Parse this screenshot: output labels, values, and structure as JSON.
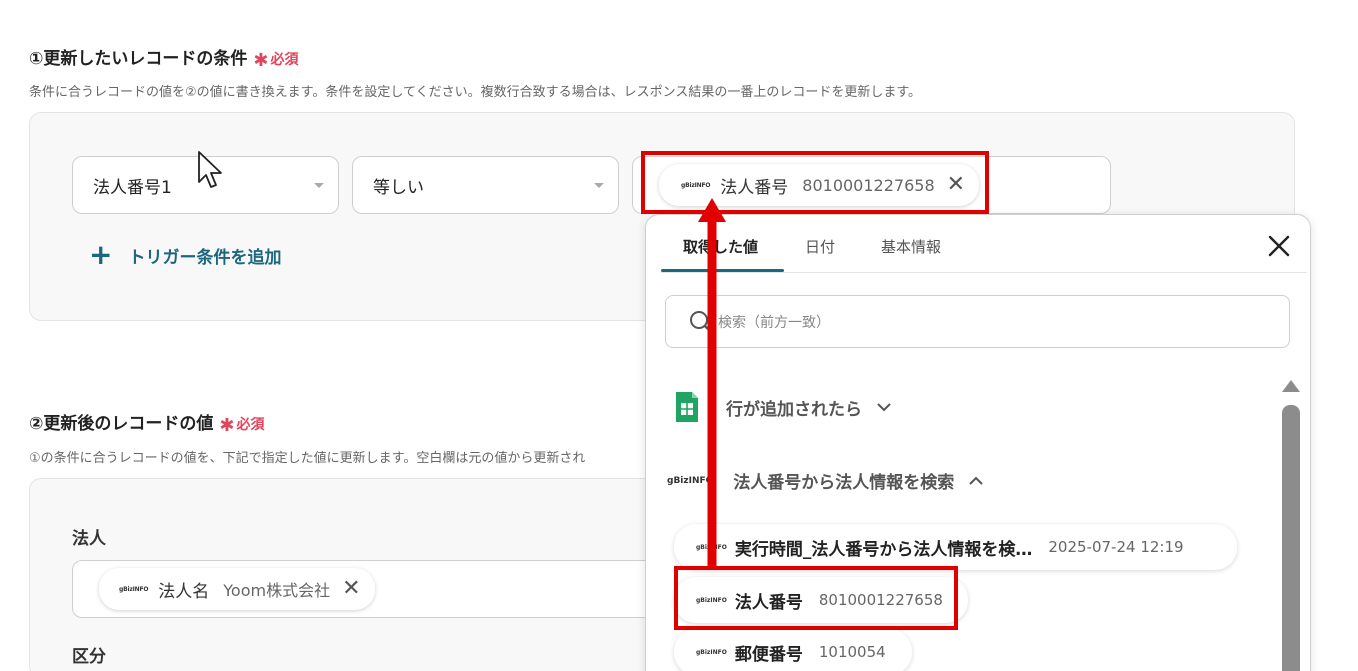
{
  "section1": {
    "title": "①更新したいレコードの条件",
    "required": "必須",
    "description": "条件に合うレコードの値を②の値に書き換えます。条件を設定してください。複数行合致する場合は、レスポンス結果の一番上のレコードを更新します。"
  },
  "condition": {
    "field": "法人番号1",
    "operator": "等しい",
    "value_chip": {
      "label": "法人番号",
      "value": "8010001227658"
    },
    "add_label": "トリガー条件を追加"
  },
  "section2": {
    "title": "②更新後のレコードの値",
    "required": "必須",
    "description": "①の条件に合うレコードの値を、下記で指定した値に更新します。空白欄は元の値から更新され"
  },
  "fields": [
    {
      "label": "法人",
      "chip": {
        "label": "法人名",
        "value": "Yoom株式会社"
      }
    },
    {
      "label": "区分"
    }
  ],
  "icons": {
    "gbiz": "gBizINFO",
    "star": "✱",
    "close": "✕",
    "plus": "+",
    "chevron_down": "⌄",
    "chevron_up": "⌃"
  },
  "popup": {
    "tabs": [
      "取得した値",
      "日付",
      "基本情報"
    ],
    "active_tab": 0,
    "search_placeholder": "検索（前方一致）",
    "groups": [
      {
        "label": "行が追加されたら",
        "icon": "google-sheets-icon",
        "expanded": false
      },
      {
        "label": "法人番号から法人情報を検索",
        "icon": "gbizinfo-icon",
        "expanded": true
      }
    ],
    "items": [
      {
        "label": "実行時間_法人番号から法人情報を検…",
        "value": "2025-07-24 12:19"
      },
      {
        "label": "法人番号",
        "value": "8010001227658"
      },
      {
        "label": "郵便番号",
        "value": "1010054"
      }
    ]
  },
  "colors": {
    "accent": "#1c6680",
    "required": "#e2455b",
    "highlight": "#e00000",
    "sheets_green": "#1fa463"
  }
}
